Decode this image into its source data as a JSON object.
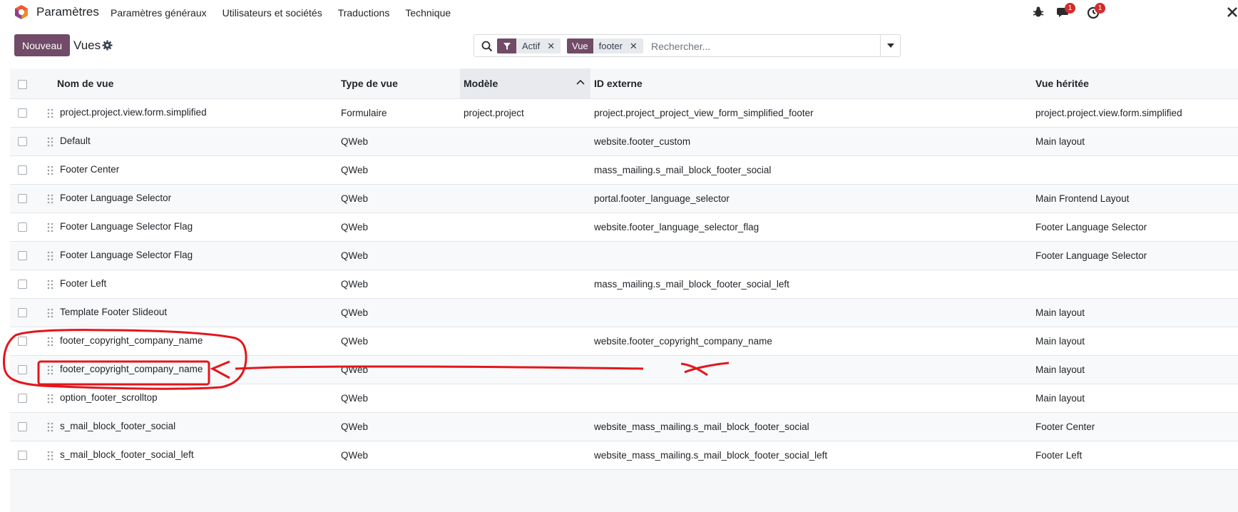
{
  "app": {
    "title": "Paramètres"
  },
  "menu": [
    "Paramètres généraux",
    "Utilisateurs et sociétés",
    "Traductions",
    "Technique"
  ],
  "systray": {
    "messages_badge": "1",
    "activities_badge": "1"
  },
  "control": {
    "new_label": "Nouveau",
    "title": "Vues"
  },
  "search": {
    "facets": [
      {
        "tag": "",
        "tag_icon": "filter-icon",
        "value": "Actif"
      },
      {
        "tag": "Vue",
        "value": "footer"
      }
    ],
    "placeholder": "Rechercher..."
  },
  "table": {
    "columns": [
      "Nom de vue",
      "Type de vue",
      "Modèle",
      "ID externe",
      "Vue héritée"
    ],
    "sorted_column": "Modèle",
    "rows": [
      [
        "project.project.view.form.simplified",
        "Formulaire",
        "project.project",
        "project.project_project_view_form_simplified_footer",
        "project.project.view.form.simplified"
      ],
      [
        "Default",
        "QWeb",
        "",
        "website.footer_custom",
        "Main layout"
      ],
      [
        "Footer Center",
        "QWeb",
        "",
        "mass_mailing.s_mail_block_footer_social",
        ""
      ],
      [
        "Footer Language Selector",
        "QWeb",
        "",
        "portal.footer_language_selector",
        "Main Frontend Layout"
      ],
      [
        "Footer Language Selector Flag",
        "QWeb",
        "",
        "website.footer_language_selector_flag",
        "Footer Language Selector"
      ],
      [
        "Footer Language Selector Flag",
        "QWeb",
        "",
        "",
        "Footer Language Selector"
      ],
      [
        "Footer Left",
        "QWeb",
        "",
        "mass_mailing.s_mail_block_footer_social_left",
        ""
      ],
      [
        "Template Footer Slideout",
        "QWeb",
        "",
        "",
        "Main layout"
      ],
      [
        "footer_copyright_company_name",
        "QWeb",
        "",
        "website.footer_copyright_company_name",
        "Main layout"
      ],
      [
        "footer_copyright_company_name",
        "QWeb",
        "",
        "",
        "Main layout"
      ],
      [
        "option_footer_scrolltop",
        "QWeb",
        "",
        "",
        "Main layout"
      ],
      [
        "s_mail_block_footer_social",
        "QWeb",
        "",
        "website_mass_mailing.s_mail_block_footer_social",
        "Footer Center"
      ],
      [
        "s_mail_block_footer_social_left",
        "QWeb",
        "",
        "website_mass_mailing.s_mail_block_footer_social_left",
        "Footer Left"
      ]
    ]
  },
  "colors": {
    "brand": "#714b67",
    "annotation": "#e3161b"
  }
}
